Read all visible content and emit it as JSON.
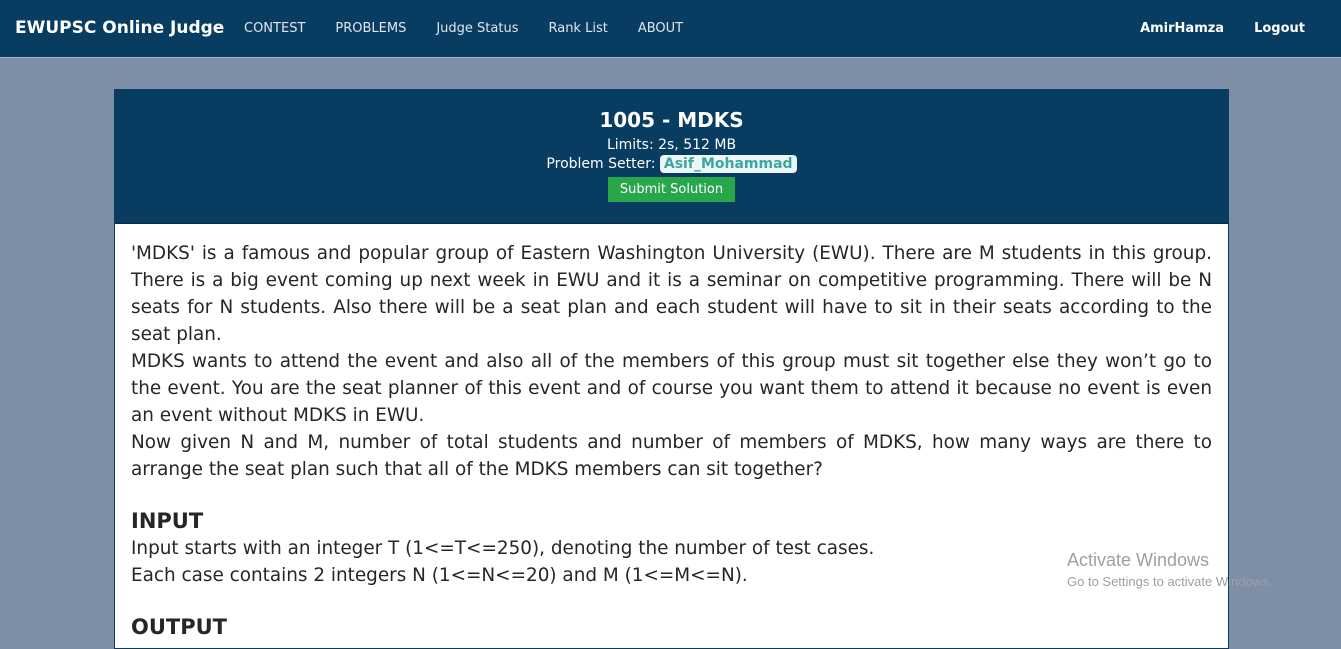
{
  "navbar": {
    "brand": "EWUPSC Online Judge",
    "links": [
      "CONTEST",
      "PROBLEMS",
      "Judge Status",
      "Rank List",
      "ABOUT"
    ],
    "user": "AmirHamza",
    "logout": "Logout"
  },
  "problem": {
    "title": "1005 - MDKS",
    "limits": "Limits: 2s, 512 MB",
    "setter_label": "Problem Setter:",
    "setter_name": "Asif_Mohammad",
    "submit_label": "Submit Solution",
    "statement": [
      "'MDKS' is a famous and popular group of Eastern Washington University (EWU). There are M students in this group. There is a big event coming up next week in EWU and it is a seminar on competitive programming. There will be N seats for N students. Also there will be a seat plan and each student will have to sit in their seats according to the seat plan.",
      "MDKS wants to attend the event and also all of the members of this group must sit together else they won’t go to the event. You are the seat planner of this event and of course you want them to attend it because no event is even an event without MDKS in EWU.",
      "Now given N and M, number of total students and number of members of MDKS, how many ways are there to arrange the seat plan such that all of the MDKS members can sit together?"
    ],
    "input_title": "INPUT",
    "input_lines": [
      "Input starts with an integer T (1<=T<=250), denoting the number of test cases.",
      "Each case contains 2 integers N (1<=N<=20) and M (1<=M<=N)."
    ],
    "output_title": "OUTPUT"
  },
  "watermark": {
    "line1": "Activate Windows",
    "line2": "Go to Settings to activate Windows."
  }
}
